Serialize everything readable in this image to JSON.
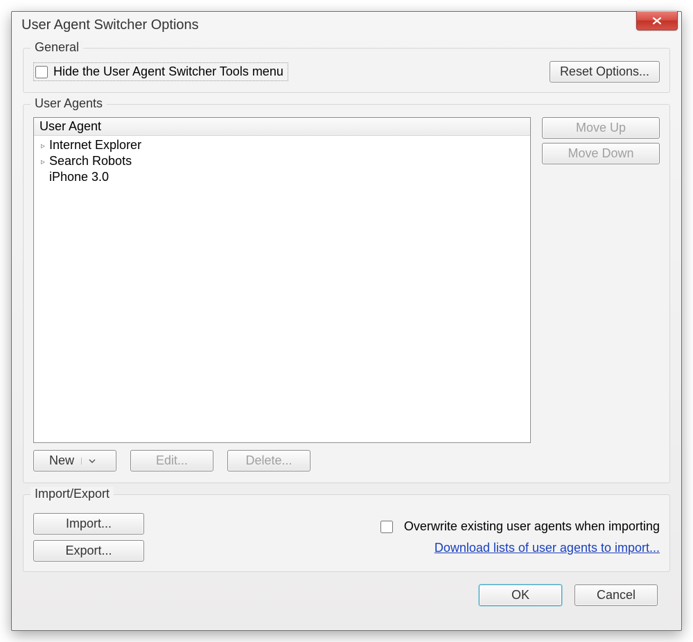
{
  "window": {
    "title": "User Agent Switcher Options"
  },
  "general": {
    "legend": "General",
    "hide_menu_label": "Hide the User Agent Switcher Tools menu",
    "reset_label": "Reset Options..."
  },
  "user_agents": {
    "legend": "User Agents",
    "column_header": "User Agent",
    "items": [
      {
        "label": "Internet Explorer",
        "expandable": true
      },
      {
        "label": "Search Robots",
        "expandable": true
      },
      {
        "label": "iPhone 3.0",
        "expandable": false
      }
    ],
    "move_up": "Move Up",
    "move_down": "Move Down",
    "new_label": "New",
    "edit_label": "Edit...",
    "delete_label": "Delete..."
  },
  "import_export": {
    "legend": "Import/Export",
    "import_label": "Import...",
    "export_label": "Export...",
    "overwrite_label": "Overwrite existing user agents when importing",
    "download_link": "Download lists of user agents to import..."
  },
  "buttons": {
    "ok": "OK",
    "cancel": "Cancel"
  }
}
